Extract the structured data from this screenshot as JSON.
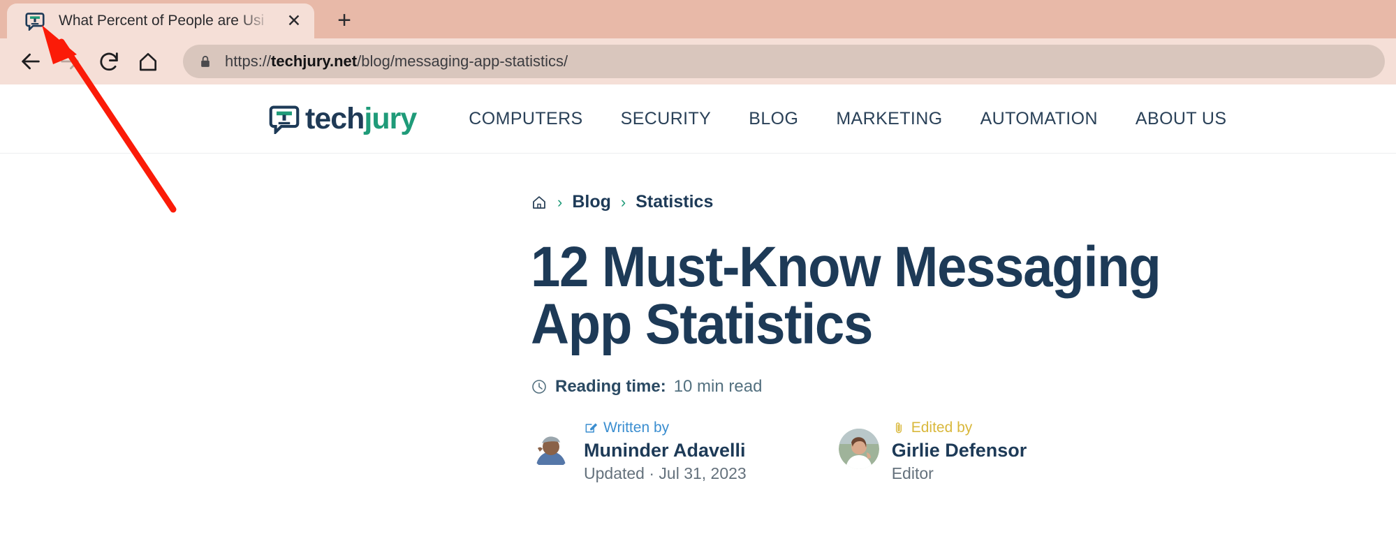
{
  "browser": {
    "tab": {
      "title": "What Percent of People are Usi",
      "favicon_icon": "techjury-speech-bubble-icon",
      "close_label": "✕"
    },
    "new_tab_label": "+",
    "nav": {
      "back_icon": "arrow-left-icon",
      "forward_icon": "arrow-right-icon",
      "reload_icon": "reload-icon",
      "home_icon": "home-icon"
    },
    "omnibox": {
      "lock_icon": "lock-icon",
      "scheme": "https://",
      "host": "techjury.net",
      "path": "/blog/messaging-app-statistics/",
      "full_url": "https://techjury.net/blog/messaging-app-statistics/"
    },
    "colors": {
      "chrome_bg": "#e8b9a8",
      "tab_active_bg": "#f5dfd7",
      "omnibox_bg": "#d9c6bd"
    }
  },
  "site": {
    "logo": {
      "part1": "tech",
      "part2": "jury",
      "icon": "techjury-speech-bubble-icon"
    },
    "nav_items": [
      {
        "label": "COMPUTERS"
      },
      {
        "label": "SECURITY"
      },
      {
        "label": "BLOG"
      },
      {
        "label": "MARKETING"
      },
      {
        "label": "AUTOMATION"
      },
      {
        "label": "ABOUT US"
      }
    ],
    "colors": {
      "navy": "#1d3a57",
      "green": "#1f9b79",
      "blue": "#3b8ed0",
      "gold": "#d9b83c"
    }
  },
  "article": {
    "breadcrumb": {
      "home_icon": "home-icon",
      "separator": "›",
      "items": [
        {
          "label": "Blog"
        },
        {
          "label": "Statistics"
        }
      ]
    },
    "title": "12 Must-Know Messaging App Statistics",
    "reading_time": {
      "icon": "clock-icon",
      "label": "Reading time:",
      "value": "10 min read"
    },
    "bylines": [
      {
        "role_label": "Written by",
        "role_icon": "pencil-edit-icon",
        "name": "Muninder Adavelli",
        "sub": "Updated · Jul 31, 2023",
        "avatar": "author-avatar"
      },
      {
        "role_label": "Edited by",
        "role_icon": "paperclip-icon",
        "name": "Girlie Defensor",
        "sub": "Editor",
        "avatar": "editor-avatar"
      }
    ]
  },
  "annotation": {
    "arrow_color": "#fb1b08",
    "arrow_icon": "red-pointer-arrow"
  }
}
